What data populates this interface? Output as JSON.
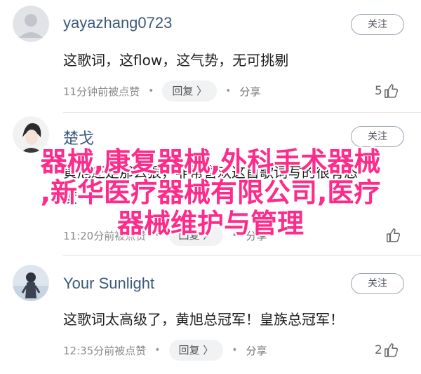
{
  "comments": [
    {
      "username": "yayazhang0723",
      "follow_label": "关注",
      "text": "这歌词，这flow，这气势，无可挑剔",
      "meta": {
        "time": "11分钟前被点赞",
        "reply_label": "回复 〉",
        "share_label": "分享",
        "likes": "5"
      }
    },
    {
      "username": "楚戈",
      "follow_label": "关注",
      "text_line1": "黄旭还是那么狠，非常喜欢这首歌词写的很有态",
      "text_line2": "度",
      "meta": {
        "time": "11:20分前被点赞",
        "reply_label": "回复 〉",
        "share_label": "分享",
        "likes": ""
      }
    },
    {
      "username": "Your Sunlight",
      "follow_label": "关注",
      "text": "这歌词太高级了，黄旭总冠军！皇族总冠军！",
      "meta": {
        "time": "12:35分前被点赞",
        "reply_label": "回复 〉",
        "share_label": "分享",
        "likes": "2"
      }
    }
  ],
  "overlay": {
    "line1": "器械,康复器械,外科手术器械",
    "line2": ",新华医疗器械有限公司,医疗",
    "line3": "器械维护与管理"
  },
  "colors": {
    "overlay": "#ff2a8a",
    "username": "#3a5a7a"
  },
  "icons": [
    "avatar",
    "dot-separator",
    "thumbs-up-icon"
  ]
}
